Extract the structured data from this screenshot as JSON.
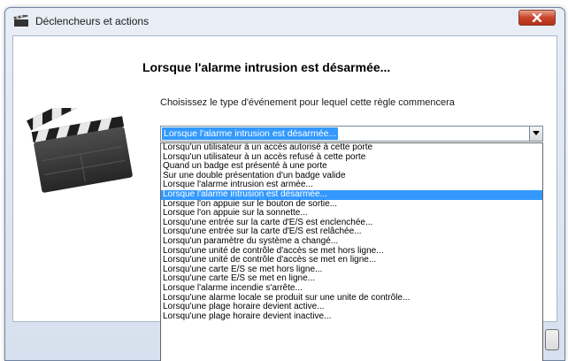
{
  "window": {
    "title": "Déclencheurs et actions",
    "close_icon": "close-x-icon",
    "app_icon": "clapperboard-icon"
  },
  "main": {
    "heading": "Lorsque l'alarme intrusion est désarmée...",
    "prompt": "Choisissez le type d'événement pour lequel cette règle commencera",
    "illustration_icon": "clapperboard-icon"
  },
  "event_select": {
    "selected_value": "Lorsque l'alarme intrusion est désarmée...",
    "options": [
      "Lorsqu'un utilisateur à un accès autorisé à cette porte",
      "Lorsqu'un utilisateur à un accès refusé à cette porte",
      "Quand un badge est présenté à une porte",
      "Sur une double présentation d'un badge valide",
      "Lorsque l'alarme intrusion est armée...",
      "Lorsque l'alarme intrusion est désarmée...",
      "Lorsque l'on appuie sur le bouton de sortie...",
      "Lorsque l'on appuie sur la sonnette...",
      "Lorsqu'une entrée sur la carte d'E/S est enclenchée...",
      "Lorsqu'une entrée sur la carte d'E/S est relâchée...",
      "Lorsqu'un paramètre du système a changé...",
      "Lorsqu'une unité de contrôle d'accès se met hors ligne...",
      "Lorsqu'une unité de contrôle d'accès se met en ligne...",
      "Lorsqu'une carte E/S se met hors ligne...",
      "Lorsqu'une carte E/S se met en ligne...",
      "Lorsque l'alarme incendie s'arrête...",
      "Lorsqu'une alarme locale se produit sur une unite de contrôle...",
      "Lorsqu'une plage horaire devient active...",
      "Lorsqu'une plage horaire devient inactive..."
    ],
    "selected_index": 5,
    "accent_color": "#3399ff"
  }
}
